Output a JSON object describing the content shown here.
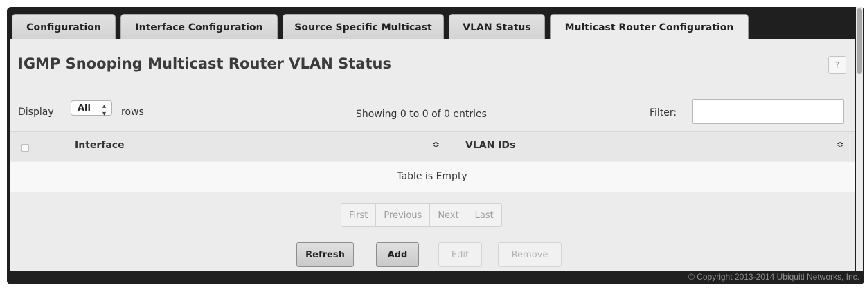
{
  "tabs": [
    {
      "label": "Configuration",
      "active": false
    },
    {
      "label": "Interface Configuration",
      "active": false
    },
    {
      "label": "Source Specific Multicast",
      "active": false
    },
    {
      "label": "VLAN Status",
      "active": false
    },
    {
      "label": "Multicast Router Configuration",
      "active": true
    }
  ],
  "page": {
    "title": "IGMP Snooping Multicast Router VLAN Status",
    "help_label": "?"
  },
  "table_controls": {
    "display_label": "Display",
    "rows_selected": "All",
    "rows_label": "rows",
    "showing_text": "Showing 0 to 0 of 0 entries",
    "filter_label": "Filter:",
    "filter_value": ""
  },
  "table": {
    "columns": [
      "Interface",
      "VLAN IDs"
    ],
    "sort_icon": "sort-updown-icon",
    "empty_text": "Table is Empty"
  },
  "pagination": {
    "first": "First",
    "previous": "Previous",
    "next": "Next",
    "last": "Last"
  },
  "actions": {
    "refresh": "Refresh",
    "add": "Add",
    "edit": "Edit",
    "remove": "Remove"
  },
  "footer": {
    "copyright": "© Copyright 2013-2014 Ubiquiti Networks, Inc."
  },
  "colors": {
    "frame": "#1f1f1f",
    "panel": "#ececec",
    "tab": "#d8d8d8"
  }
}
